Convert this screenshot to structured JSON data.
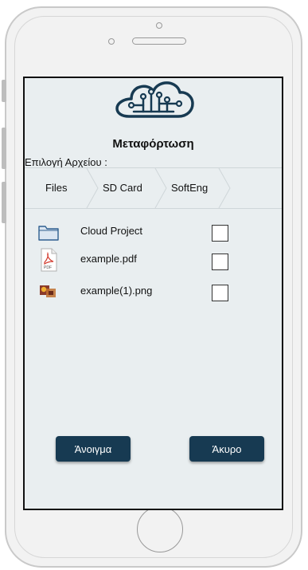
{
  "app": {
    "title": "Μεταφόρτωση",
    "subtitle": "Επιλογή Αρχείου :"
  },
  "breadcrumbs": [
    {
      "label": "Files"
    },
    {
      "label": "SD Card"
    },
    {
      "label": "SoftEng"
    }
  ],
  "files": [
    {
      "name": "Cloud Project",
      "icon": "folder-icon",
      "checked": false
    },
    {
      "name": "example.pdf",
      "icon": "pdf-file-icon",
      "checked": false
    },
    {
      "name": "example(1).png",
      "icon": "image-file-icon",
      "checked": false
    }
  ],
  "buttons": {
    "open_label": "Άνοιγμα",
    "cancel_label": "Άκυρο"
  },
  "colors": {
    "screen_bg": "#e9eef0",
    "button_bg": "#173a52",
    "logo": "#173a52"
  }
}
